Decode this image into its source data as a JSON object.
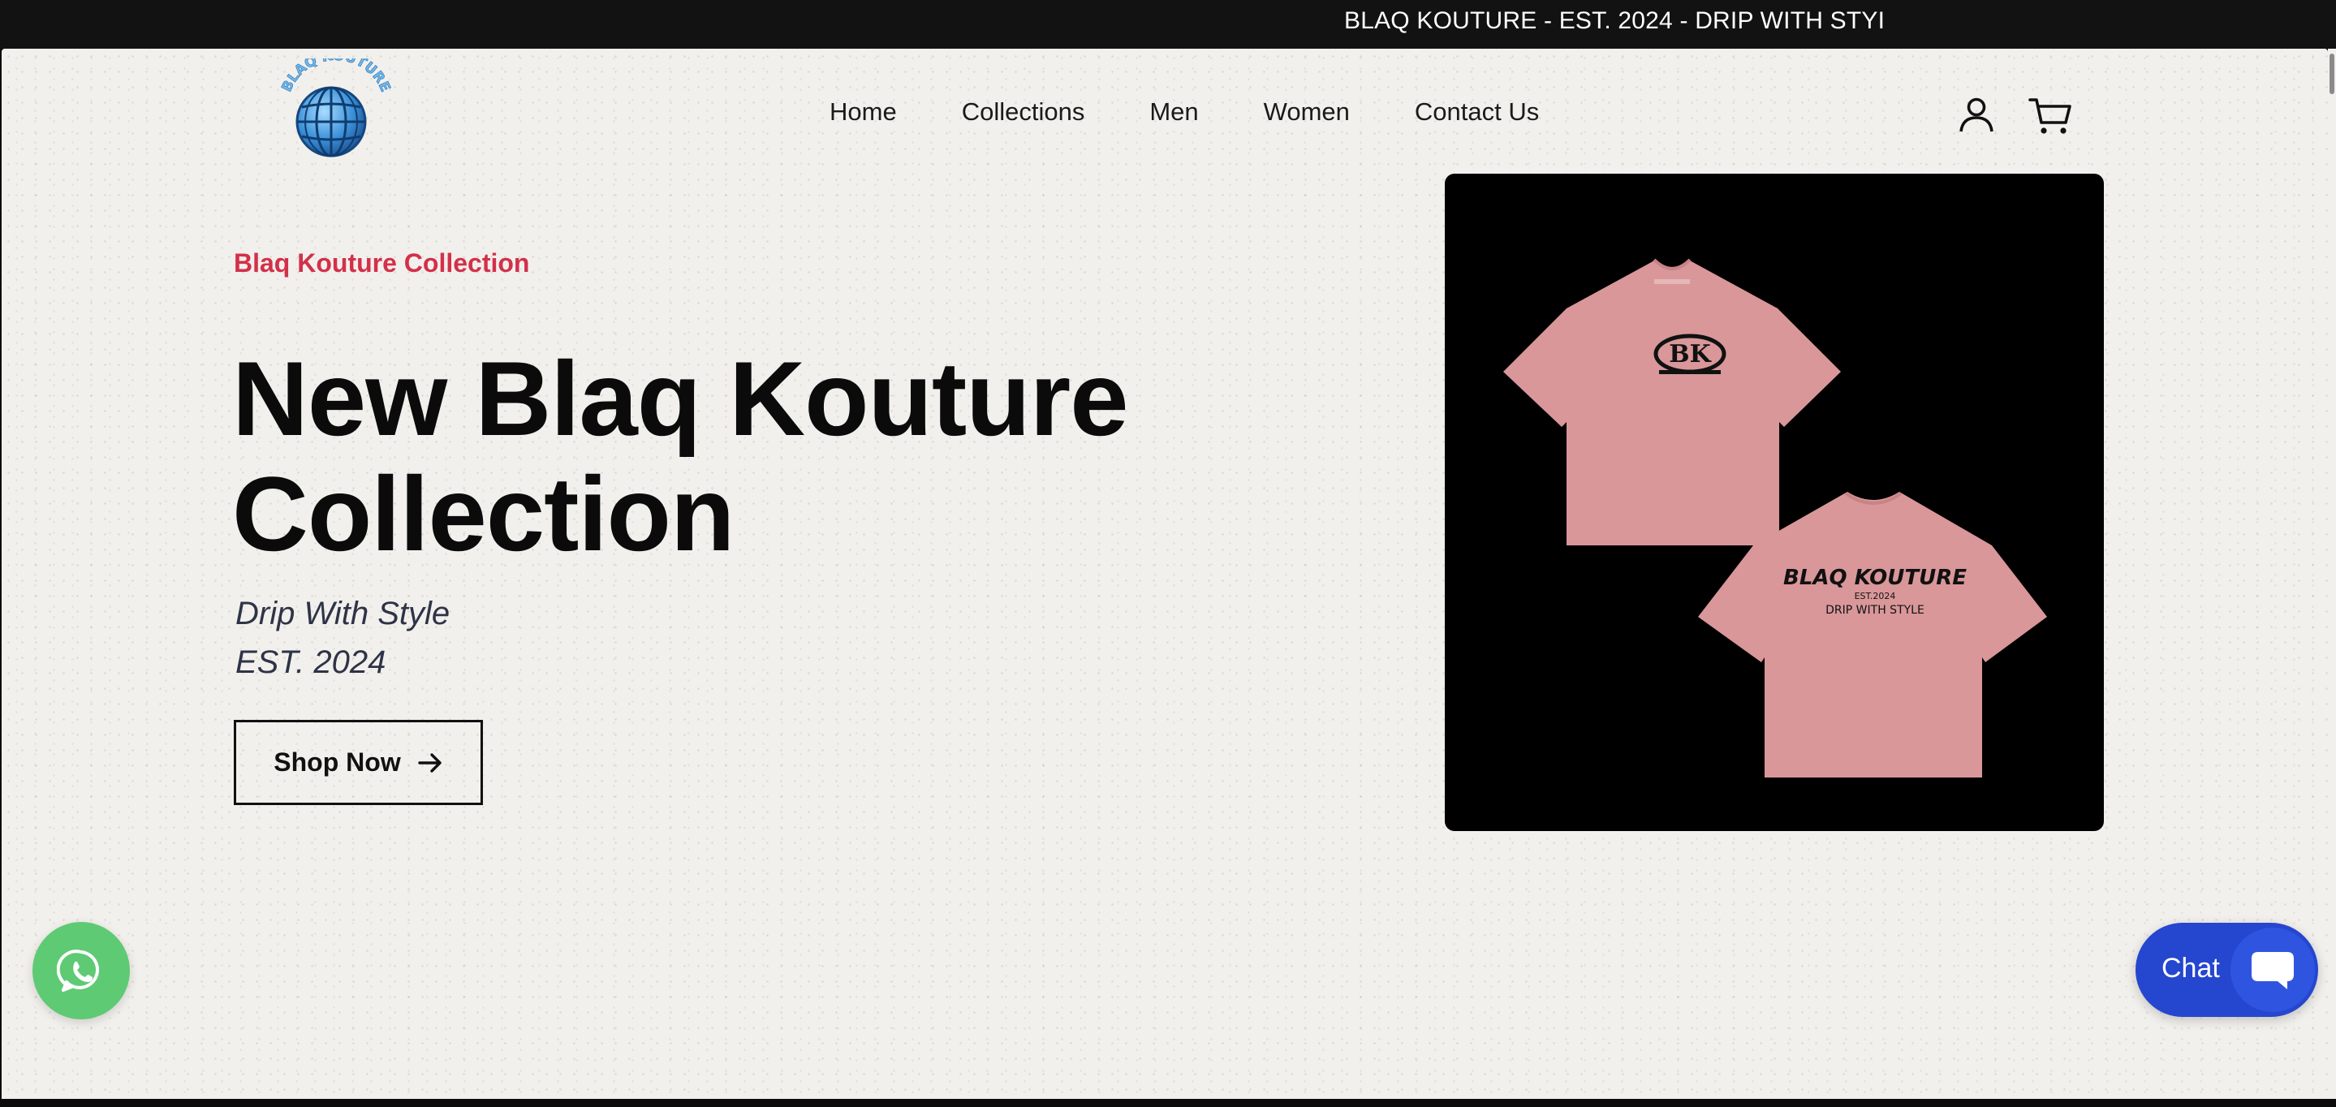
{
  "announcement": {
    "text": "BLAQ KOUTURE - EST. 2024 - DRIP WITH STYI"
  },
  "brand": {
    "logo_text": "BLAQ KOUTURE"
  },
  "nav": {
    "items": [
      {
        "label": "Home"
      },
      {
        "label": "Collections"
      },
      {
        "label": "Men"
      },
      {
        "label": "Women"
      },
      {
        "label": "Contact Us"
      }
    ]
  },
  "header_icons": [
    "account-icon",
    "cart-icon"
  ],
  "hero": {
    "eyebrow": "Blaq Kouture Collection",
    "headline_line1": "New Blaq Kouture",
    "headline_line2": "Collection",
    "subtitle_line1": "Drip With Style",
    "subtitle_line2": "EST. 2024",
    "cta_label": "Shop Now",
    "image": {
      "front_print": "BK",
      "back_print_title": "BLAQ KOUTURE",
      "back_print_est": "EST.2024",
      "back_print_tagline": "DRIP WITH STYLE"
    }
  },
  "widgets": {
    "chat_label": "Chat"
  },
  "colors": {
    "accent": "#d3304a",
    "announcement_bg": "#121212",
    "page_bg": "#f2f0ec",
    "chat_bg": "#2546cf",
    "whatsapp": "#5fca74",
    "shirt": "#d9979a"
  }
}
